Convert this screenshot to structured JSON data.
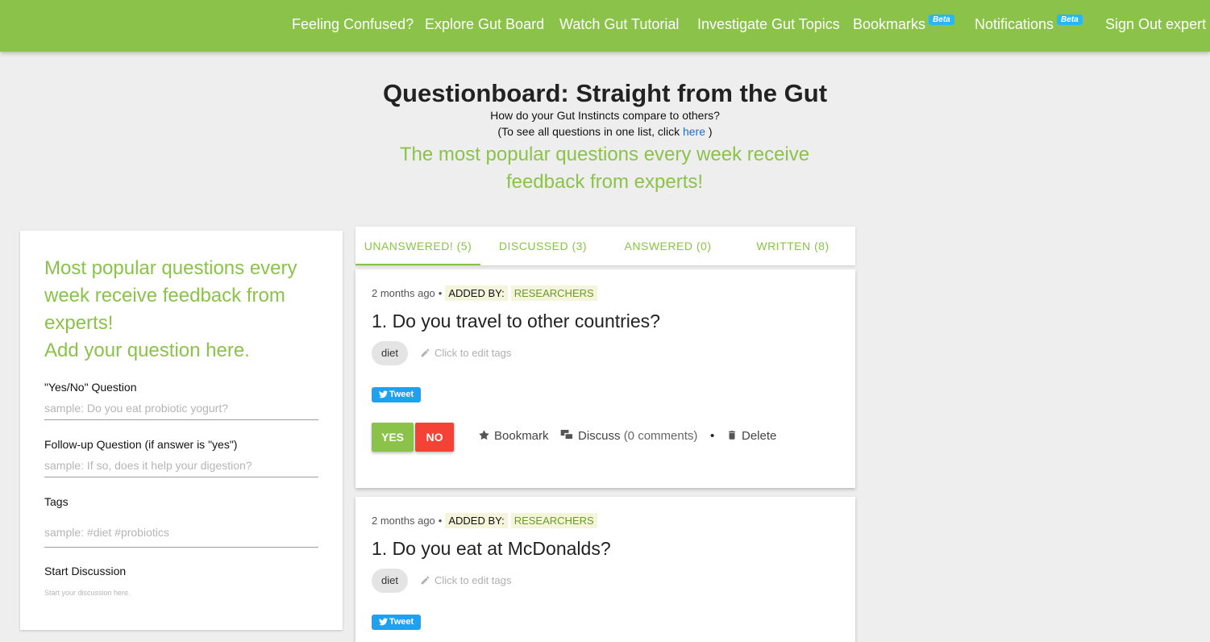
{
  "nav": {
    "feeling_confused": "Feeling Confused?",
    "explore": "Explore Gut Board",
    "watch": "Watch Gut Tutorial",
    "investigate": "Investigate Gut Topics",
    "bookmarks": "Bookmarks",
    "bookmarks_badge": "Beta",
    "notifications": "Notifications",
    "notifications_badge": "Beta",
    "sign_out": "Sign Out expert"
  },
  "header": {
    "title": "Questionboard: Straight from the Gut",
    "subtitle": "How do your Gut Instincts compare to others?",
    "list_prefix": "(To see all questions in one list, click ",
    "list_link": "here",
    "list_suffix": " )",
    "promo": "The most popular questions every week receive feedback from experts!"
  },
  "form": {
    "heading_line1": "Most popular questions every week receive feedback from experts!",
    "heading_line2": "Add your question here.",
    "yes_no_label": "\"Yes/No\" Question",
    "yes_no_placeholder": "sample: Do you eat probiotic yogurt?",
    "followup_label": "Follow-up Question (if answer is \"yes\")",
    "followup_placeholder": "sample: If so, does it help your digestion?",
    "tags_label": "Tags",
    "tags_placeholder": "sample: #diet #probiotics",
    "discussion_label": "Start Discussion",
    "discussion_placeholder": "Start your discussion here."
  },
  "tabs": [
    {
      "label": "UNANSWERED! (5)"
    },
    {
      "label": "DISCUSSED (3)"
    },
    {
      "label": "ANSWERED (0)"
    },
    {
      "label": "WRITTEN (8)"
    }
  ],
  "questions": [
    {
      "time": "2 months ago",
      "added_by_label": "ADDED BY:",
      "added_by": "RESEARCHERS",
      "text": "1. Do you travel to other countries?",
      "tag": "diet",
      "edit_tags": "Click to edit tags",
      "tweet": "Tweet",
      "yes": "YES",
      "no": "NO",
      "bookmark": "Bookmark",
      "discuss": "Discuss",
      "comments": "(0 comments)",
      "delete": "Delete"
    },
    {
      "time": "2 months ago",
      "added_by_label": "ADDED BY:",
      "added_by": "RESEARCHERS",
      "text": "1. Do you eat at McDonalds?",
      "tag": "diet",
      "edit_tags": "Click to edit tags",
      "tweet": "Tweet"
    }
  ],
  "colors": {
    "accent": "#8bc34a",
    "no": "#f44336",
    "tweet": "#1da1f2",
    "beta": "#29b6f6"
  }
}
